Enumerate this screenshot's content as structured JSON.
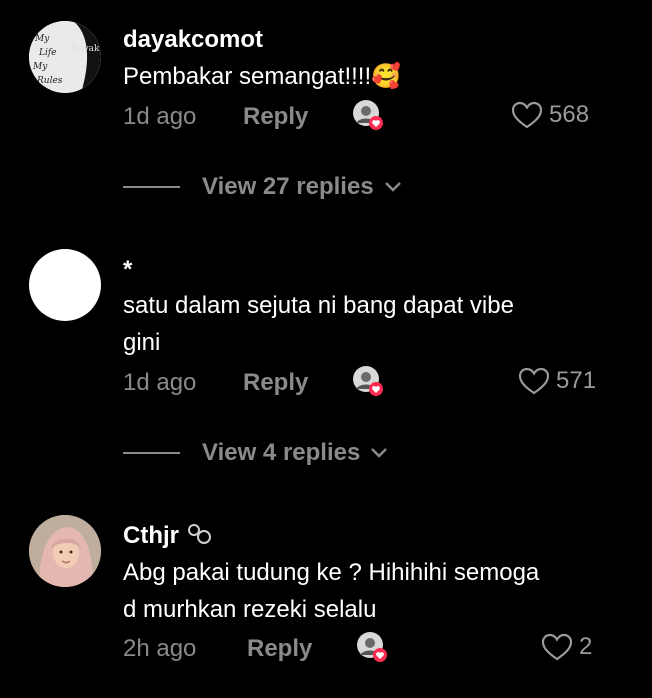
{
  "comments": [
    {
      "username": "dayakcomot",
      "text": "Pembakar semangat!!!!🥰",
      "time": "1d ago",
      "reply_label": "Reply",
      "likes": "568",
      "avatar_label": "Dayak",
      "avatar_text": "My Life My Rules",
      "view_replies": "View 27 replies"
    },
    {
      "username": "*",
      "text_line1": "satu dalam sejuta ni bang dapat vibe",
      "text_line2": "gini",
      "time": "1d ago",
      "reply_label": "Reply",
      "likes": "571",
      "view_replies": "View 4 replies"
    },
    {
      "username": "Cthjr",
      "text_line1": "Abg pakai tudung ke ? Hihihihi semoga",
      "text_line2": "d murhkan rezeki selalu",
      "time": "2h ago",
      "reply_label": "Reply",
      "likes": "2"
    }
  ],
  "colors": {
    "background": "#000000",
    "text": "#ffffff",
    "muted": "#8a8a8a",
    "heart_badge": "#fe2c55"
  },
  "icons": [
    "heart-outline-icon",
    "chevron-down-icon",
    "liked-by-creator-icon"
  ]
}
